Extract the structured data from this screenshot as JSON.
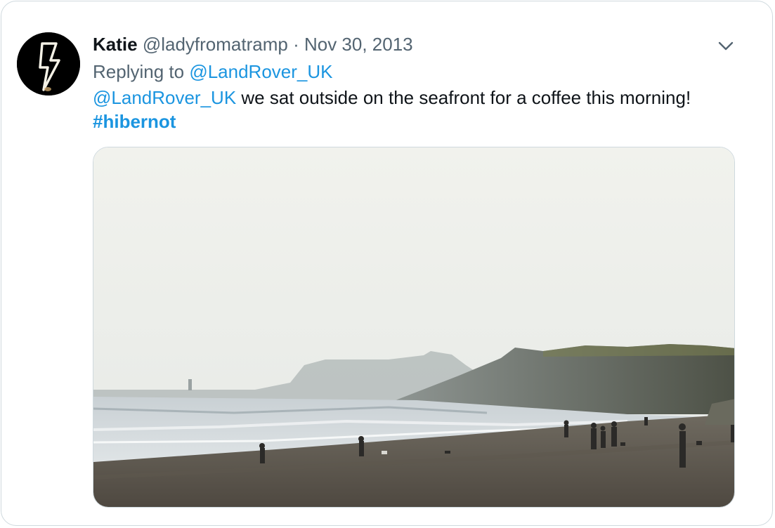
{
  "tweet": {
    "author_name": "Katie",
    "author_handle": "@ladyfromatramp",
    "separator": "·",
    "date": "Nov 30, 2013",
    "replying_to_prefix": "Replying to",
    "replying_to_handle": "@LandRover_UK",
    "mention": "@LandRover_UK",
    "text": " we sat outside on the seafront for a coffee this morning!",
    "hashtag": "#hibernot"
  },
  "icons": {
    "avatar": "lightning-bolt-icon",
    "menu": "chevron-down-icon"
  },
  "colors": {
    "link": "#1b95e0",
    "secondary_text": "#536471",
    "primary_text": "#0f1419",
    "border": "#cfd9de"
  }
}
